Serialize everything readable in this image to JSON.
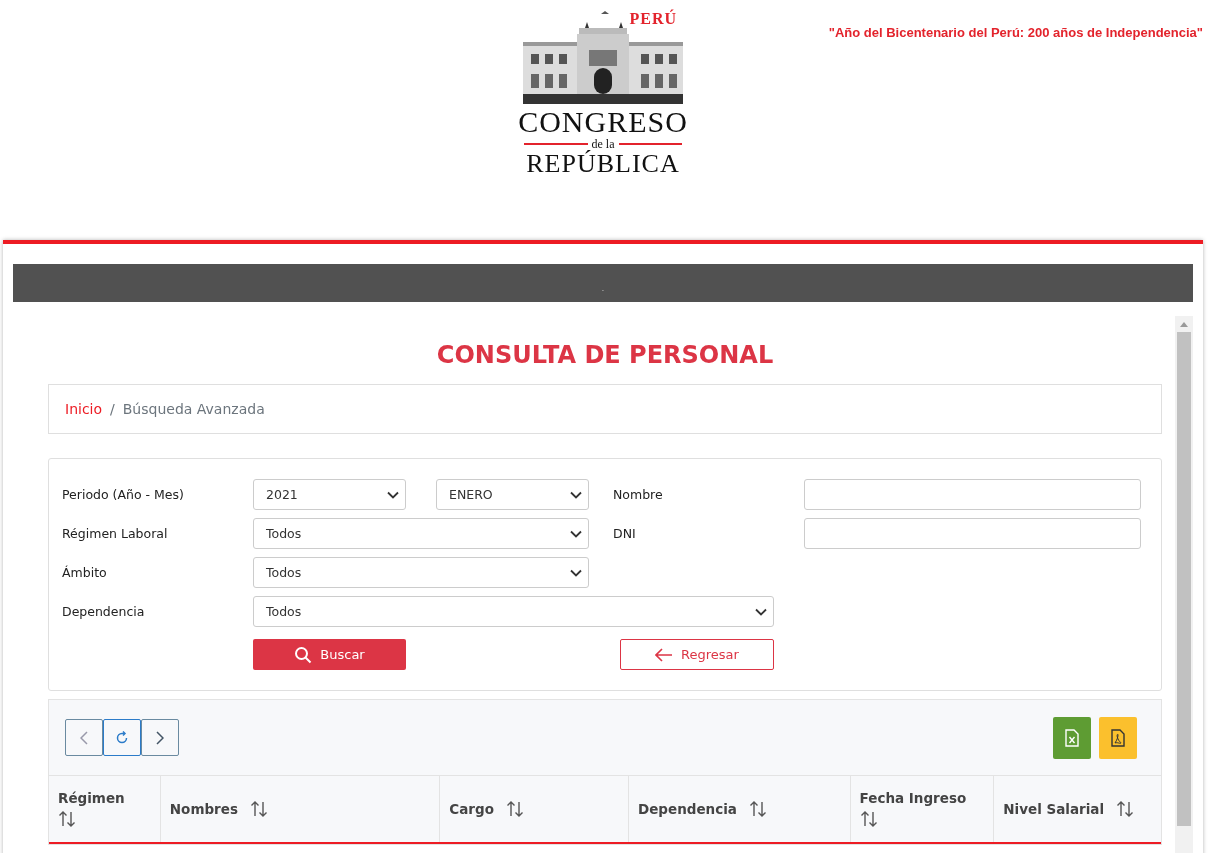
{
  "header": {
    "logo": {
      "country": "PERÚ",
      "line1": "CONGRESO",
      "line2": "de la",
      "line3": "REPÚBLICA"
    },
    "motto": "\"Año del Bicentenario del Perú: 200 años de Independencia\""
  },
  "top_bar": {
    "text": "."
  },
  "title": "CONSULTA DE PERSONAL",
  "breadcrumb_separator": "/",
  "breadcrumb": [
    {
      "label": "Inicio",
      "kind": "link"
    },
    {
      "label": "Búsqueda Avanzada",
      "kind": "current"
    }
  ],
  "filters": {
    "periodo_label": "Periodo (Año - Mes)",
    "year": "2021",
    "month": "ENERO",
    "nombre_label": "Nombre",
    "regimen_label": "Régimen Laboral",
    "regimen": "Todos",
    "dni_label": "DNI",
    "ambito_label": "Ámbito",
    "ambito": "Todos",
    "dependencia_label": "Dependencia",
    "dependencia": "Todos"
  },
  "buttons": [
    {
      "label": "Buscar",
      "kind": "primary"
    },
    {
      "label": "Regresar",
      "kind": "back"
    }
  ],
  "table": {
    "columns": [
      {
        "label": "Régimen",
        "sortable": true
      },
      {
        "label": "Nombres",
        "sortable": true
      },
      {
        "label": "Cargo",
        "sortable": true
      },
      {
        "label": "Dependencia",
        "sortable": true
      },
      {
        "label": "Fecha Ingreso",
        "sortable": true
      },
      {
        "label": "Nivel Salarial",
        "sortable": true
      }
    ]
  }
}
